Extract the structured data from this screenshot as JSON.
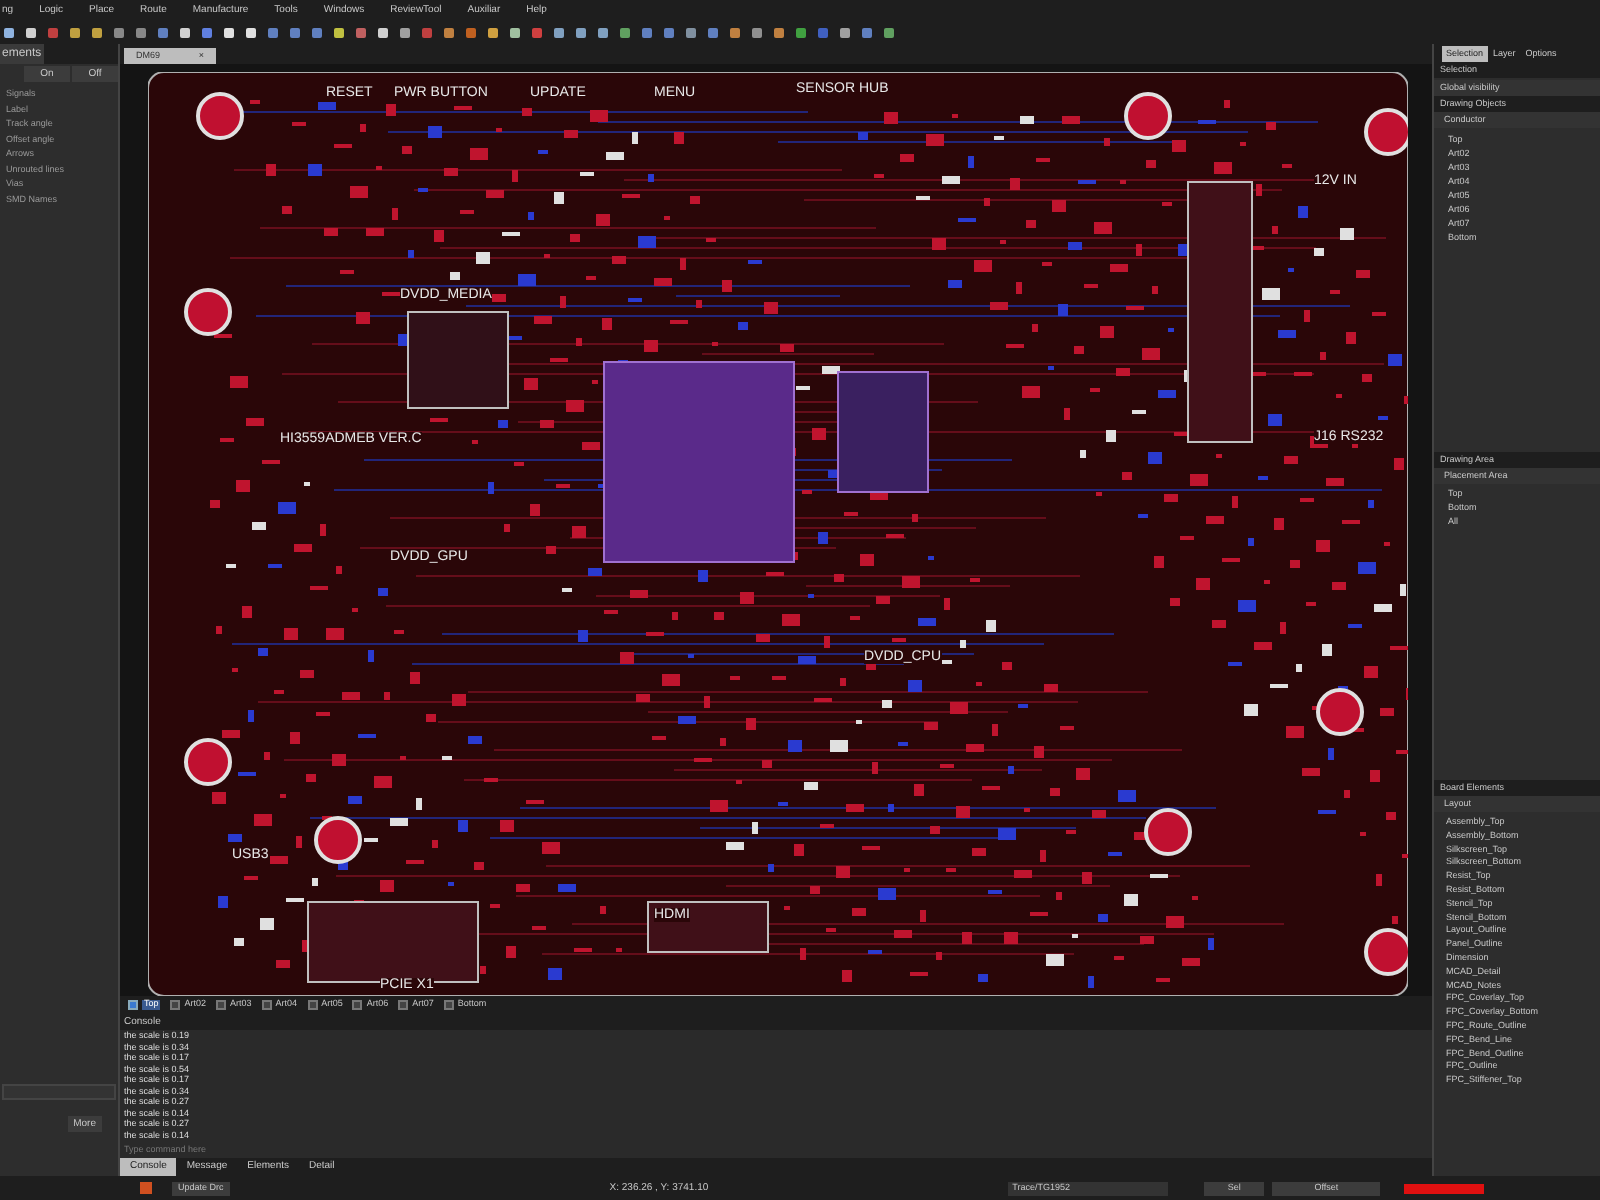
{
  "menu": [
    "ng",
    "Logic",
    "Place",
    "Route",
    "Manufacture",
    "Tools",
    "Windows",
    "ReviewTool",
    "Auxiliar",
    "Help"
  ],
  "left_panel": {
    "tab": "ements",
    "on": "On",
    "off": "Off",
    "items": [
      "Signals",
      "Label",
      "Track angle",
      "Offset angle",
      "Arrows",
      "Unrouted lines",
      "Vias",
      "SMD Names"
    ],
    "more": "More"
  },
  "document_tab": {
    "title": "DM69",
    "close": "×"
  },
  "board": {
    "labels": [
      "RESET",
      "PWR BUTTON",
      "UPDATE",
      "MENU",
      "SENSOR HUB",
      "HI3559ADMEB VER.C",
      "DVDD_MEDIA",
      "DVDD_GPU",
      "DVDD_CPU",
      "PCIE X1",
      "USB3",
      "HDMI",
      "12V IN",
      "J16 RS232"
    ]
  },
  "layers": [
    {
      "label": "Top",
      "checked": true
    },
    {
      "label": "Art02",
      "checked": false
    },
    {
      "label": "Art03",
      "checked": false
    },
    {
      "label": "Art04",
      "checked": false
    },
    {
      "label": "Art05",
      "checked": false
    },
    {
      "label": "Art06",
      "checked": false
    },
    {
      "label": "Art07",
      "checked": false
    },
    {
      "label": "Bottom",
      "checked": false
    }
  ],
  "console": {
    "title": "Console",
    "lines": [
      "the scale is 0.19",
      "the scale is 0.34",
      "the scale is 0.17",
      "the scale is 0.54",
      "the scale is 0.17",
      "the scale is 0.34",
      "the scale is 0.27",
      "the scale is 0.14",
      "the scale is 0.27",
      "the scale is 0.14"
    ],
    "placeholder": "Type command here",
    "tabs": [
      {
        "label": "Console",
        "selected": true
      },
      {
        "label": "Message",
        "selected": false
      },
      {
        "label": "Elements",
        "selected": false
      },
      {
        "label": "Detail",
        "selected": false
      }
    ]
  },
  "right_panel": {
    "tabs": [
      {
        "label": "Selection",
        "selected": true
      },
      {
        "label": "Layer",
        "selected": false
      },
      {
        "label": "Options",
        "selected": false
      }
    ],
    "title": "Selection",
    "global": "Global visibility",
    "drawing_objects": "Drawing Objects",
    "conductor": "Conductor",
    "conductor_items": [
      "Top",
      "Art02",
      "Art03",
      "Art04",
      "Art05",
      "Art06",
      "Art07",
      "Bottom"
    ],
    "drawing_area": "Drawing Area",
    "placement_area": "Placement Area",
    "placement_items": [
      "Top",
      "Bottom",
      "All"
    ],
    "board_elements": "Board Elements",
    "layout": "Layout",
    "layout_items": [
      "Assembly_Top",
      "Assembly_Bottom",
      "Silkscreen_Top",
      "Silkscreen_Bottom",
      "Resist_Top",
      "Resist_Bottom",
      "Stencil_Top",
      "Stencil_Bottom",
      "Layout_Outline",
      "Panel_Outline",
      "Dimension",
      "MCAD_Detail",
      "MCAD_Notes",
      "FPC_Coverlay_Top",
      "FPC_Coverlay_Bottom",
      "FPC_Route_Outline",
      "FPC_Bend_Line",
      "FPC_Bend_Outline",
      "FPC_Outline",
      "FPC_Stiffener_Top"
    ]
  },
  "status": {
    "update": "Update Drc",
    "coords": "X: 236.26 , Y: 3741.10",
    "trace": "Trace/TG1952",
    "sel": "Sel",
    "offset": "Offset"
  }
}
